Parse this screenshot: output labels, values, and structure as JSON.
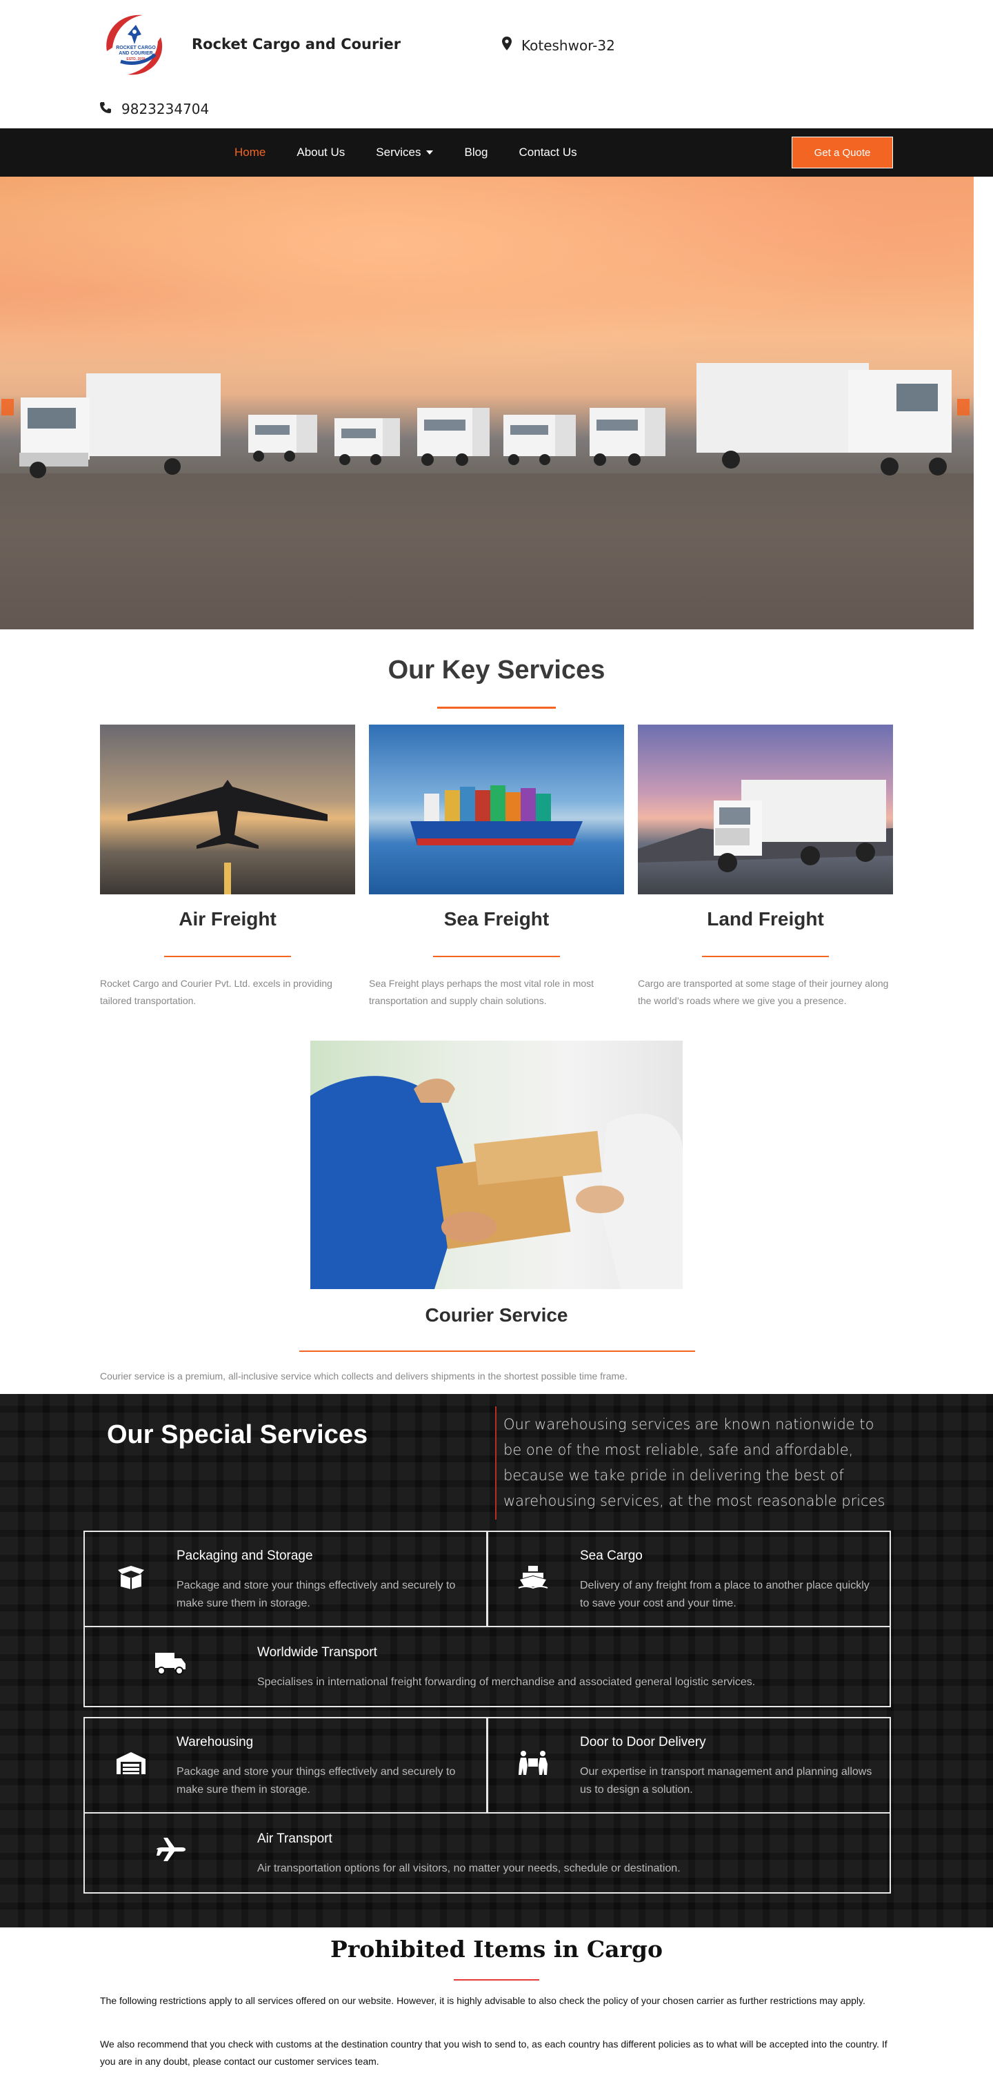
{
  "header": {
    "brand": "Rocket Cargo and Courier",
    "location": "Koteshwor-32",
    "phone": "9823234704",
    "logo_text_top": "ROCKET CARGO",
    "logo_text_bottom": "AND COURIER",
    "logo_estd": "ESTD. 2076"
  },
  "nav": {
    "items": [
      {
        "label": "Home",
        "active": true
      },
      {
        "label": "About Us"
      },
      {
        "label": "Services",
        "dropdown": true
      },
      {
        "label": "Blog"
      },
      {
        "label": "Contact Us"
      }
    ],
    "cta": "Get a Quote"
  },
  "key_services": {
    "title": "Our Key Services",
    "cards": [
      {
        "title": "Air Freight",
        "desc": "Rocket Cargo and Courier Pvt. Ltd. excels in providing tailored transportation."
      },
      {
        "title": "Sea Freight",
        "desc": "Sea Freight plays perhaps the most vital role in most transportation and supply chain solutions."
      },
      {
        "title": "Land Freight",
        "desc": "Cargo are transported at some stage of their journey along the world’s roads where we give you a presence."
      }
    ],
    "courier": {
      "title": "Courier Service",
      "desc": "Courier service is a premium, all-inclusive service which collects and delivers shipments in the shortest possible time frame."
    }
  },
  "special_services": {
    "title": "Our Special Services",
    "intro": "Our warehousing services are known nationwide to be one of the most reliable, safe and affordable, because we take pride in delivering the best of warehousing services, at the most reasonable prices",
    "items": [
      {
        "title": "Packaging and Storage",
        "desc": "Package and store your things effectively and securely to make sure them in storage.",
        "icon": "box-open-icon"
      },
      {
        "title": "Sea Cargo",
        "desc": "Delivery of any freight from a place to another place quickly to save your cost and your time.",
        "icon": "ship-icon"
      },
      {
        "title": "Worldwide Transport",
        "desc": "Specialises in international freight forwarding of merchandise and associated general logistic services.",
        "icon": "truck-icon"
      },
      {
        "title": "Warehousing",
        "desc": "Package and store your things effectively and securely to make sure them in storage.",
        "icon": "warehouse-icon"
      },
      {
        "title": "Door to Door Delivery",
        "desc": "Our expertise in transport management and planning allows us to design a solution.",
        "icon": "people-carry-icon"
      },
      {
        "title": "Air Transport",
        "desc": "Air transportation options for all visitors, no matter your needs, schedule or destination.",
        "icon": "plane-icon"
      }
    ]
  },
  "prohibited": {
    "title": "Prohibited Items in Cargo",
    "paragraphs": [
      "The following restrictions apply to all services offered on our website. However, it is highly advisable to also check the policy of your chosen carrier as further restrictions may apply.",
      "We also recommend that you check with customs at the destination country that you wish to send to, as each country has different policies as to what will be accepted into the country. If you are in any doubt, please contact our customer services team."
    ]
  },
  "colors": {
    "accent": "#f26522",
    "nav_bg": "#141414",
    "special_bg": "#0e0e0e",
    "prohibited_line": "#e53935"
  }
}
